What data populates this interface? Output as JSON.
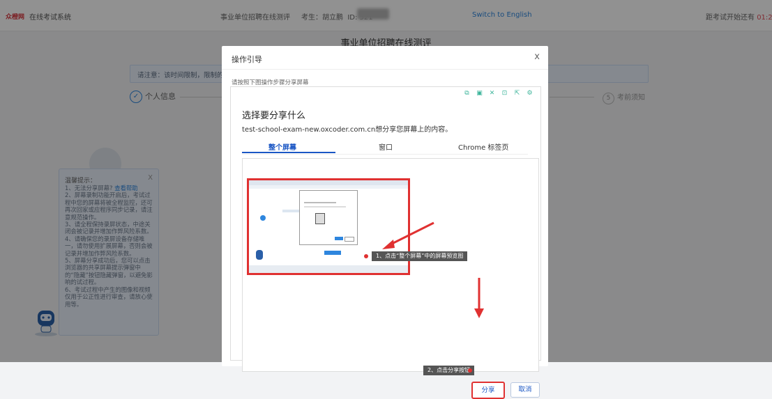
{
  "header": {
    "logo_text": "众橙网",
    "system_name": "在线考试系统",
    "exam_name": "事业单位招聘在线测评",
    "candidate": "考生：胡立鹏",
    "candidate_id": "ID: 321",
    "switch_language": "Switch to English",
    "countdown_label": "距考试开始还有",
    "countdown_value": "01:2"
  },
  "page": {
    "title": "事业单位招聘在线测评",
    "notice": "请注意：该时间限制，限制的是开",
    "steps": [
      "个人信息",
      "考前须知"
    ],
    "step5_num": "5"
  },
  "tip_panel": {
    "title": "温馨提示：",
    "close": "X",
    "items": [
      "1、无法分享屏幕?",
      "2、屏幕录制功能开启后，考试过程中您的屏幕将被全程监控，还可再次回家或应程序同步记录，请注意规范操作。",
      "3、请全程保持录屏状态，中途关闭会被记录并增加作弊风险系数。",
      "4、请确保您的录屏设备存储唯一，请勿使用扩展屏幕，否则会被记录并增加作弊风险系数。",
      "5、屏幕分享成功后，您可以点击浏览器的共享屏幕提示弹窗中的“隐藏”按钮隐藏弹窗，以避免影响的试过程。",
      "6、考试过程中产生的图像和视频仅用于公正性进行审查，请放心使用等。"
    ],
    "help_link": "查看帮助"
  },
  "modal": {
    "title": "操作引导",
    "close": "x",
    "instruction": "请按照下图操作步骤分享屏幕",
    "dialog": {
      "heading": "选择要分享什么",
      "subtitle": "test-school-exam-new.oxcoder.com.cn想分享您屏幕上的内容。",
      "tabs": [
        "整个屏幕",
        "窗口",
        "Chrome 标签页"
      ],
      "active_tab": 0,
      "step1_label": "1、点击“整个屏幕”中的屏幕预览图",
      "step2_label": "2、点击分享按钮",
      "share_button": "分享",
      "cancel_button": "取消"
    }
  },
  "colors": {
    "accent_blue": "#1a56c4",
    "highlight_red": "#e03131",
    "tip_bg": "#eaf1fb"
  }
}
